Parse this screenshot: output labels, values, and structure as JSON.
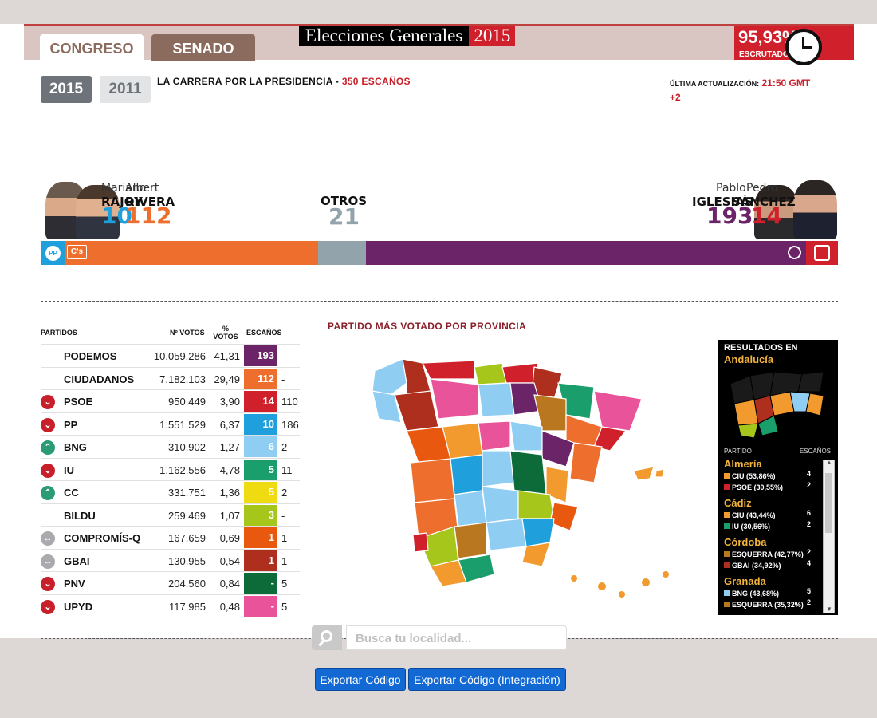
{
  "header": {
    "tabs": [
      "CONGRESO",
      "SENADO"
    ],
    "title_main": "Elecciones Generales",
    "title_year": "2015",
    "escrutado_pct": "95,93%",
    "escrutado_label": "ESCRUTADO"
  },
  "years": [
    "2015",
    "2011"
  ],
  "carrera": {
    "label": "LA CARRERA POR LA PRESIDENCIA -",
    "seats": "350 ESCAÑOS"
  },
  "update": {
    "label": "ÚLTIMA ACTUALIZACIÓN:",
    "time": "21:50 GMT",
    "tz": "+2"
  },
  "candidates": {
    "rajoy": {
      "first": "Mariano",
      "last": "RAJOY",
      "seats": "10",
      "color": "#1fa0dd"
    },
    "rivera": {
      "first": "Albert",
      "last": "RIVERA",
      "seats": "112",
      "color": "#ee6f2d"
    },
    "otros": {
      "last": "OTROS",
      "seats": "21",
      "color": "#93a3ab"
    },
    "iglesias": {
      "first": "Pablo",
      "last": "IGLESIAS",
      "seats": "193",
      "color": "#6b2467"
    },
    "sanchez": {
      "first": "Pedro",
      "last": "SÁNCHEZ",
      "seats": "14",
      "color": "#d0202b"
    }
  },
  "table": {
    "headers": {
      "partidos": "PARTIDOS",
      "votos": "Nº VOTOS",
      "pct": "% VOTOS",
      "escanos": "ESCAÑOS"
    },
    "rows": [
      {
        "trend": "none",
        "name": "PODEMOS",
        "votes": "10.059.286",
        "pct": "41,31",
        "seats": "193",
        "old": "-",
        "color": "#6b2467"
      },
      {
        "trend": "none",
        "name": "CIUDADANOS",
        "votes": "7.182.103",
        "pct": "29,49",
        "seats": "112",
        "old": "-",
        "color": "#ee6f2d"
      },
      {
        "trend": "down",
        "name": "PSOE",
        "votes": "950.449",
        "pct": "3,90",
        "seats": "14",
        "old": "110",
        "color": "#d0202b"
      },
      {
        "trend": "down",
        "name": "PP",
        "votes": "1.551.529",
        "pct": "6,37",
        "seats": "10",
        "old": "186",
        "color": "#1fa0dd"
      },
      {
        "trend": "up",
        "name": "BNG",
        "votes": "310.902",
        "pct": "1,27",
        "seats": "6",
        "old": "2",
        "color": "#8fcdf3"
      },
      {
        "trend": "down",
        "name": "IU",
        "votes": "1.162.556",
        "pct": "4,78",
        "seats": "5",
        "old": "11",
        "color": "#1a9e6b"
      },
      {
        "trend": "up",
        "name": "CC",
        "votes": "331.751",
        "pct": "1,36",
        "seats": "5",
        "old": "2",
        "color": "#efdb12"
      },
      {
        "trend": "none",
        "name": "BILDU",
        "votes": "259.469",
        "pct": "1,07",
        "seats": "3",
        "old": "-",
        "color": "#a7c61c"
      },
      {
        "trend": "same",
        "name": "COMPROMÍS-Q",
        "votes": "167.659",
        "pct": "0,69",
        "seats": "1",
        "old": "1",
        "color": "#e9580f"
      },
      {
        "trend": "same",
        "name": "GBAI",
        "votes": "130.955",
        "pct": "0,54",
        "seats": "1",
        "old": "1",
        "color": "#ae2f1d"
      },
      {
        "trend": "down",
        "name": "PNV",
        "votes": "204.560",
        "pct": "0,84",
        "seats": "-",
        "old": "5",
        "color": "#0d6b3a"
      },
      {
        "trend": "down",
        "name": "UPYD",
        "votes": "117.985",
        "pct": "0,48",
        "seats": "-",
        "old": "5",
        "color": "#e9539a"
      }
    ]
  },
  "map_title": "PARTIDO MÁS VOTADO POR PROVINCIA",
  "panel": {
    "title": "RESULTADOS EN",
    "region": "Andalucía",
    "col_party": "PARTIDO",
    "col_seats": "ESCAÑOS",
    "provinces": [
      {
        "name": "Almería",
        "lines": [
          {
            "label": "CIU (53,86%)",
            "seats": "4",
            "color": "#f29a2e"
          },
          {
            "label": "PSOE (30,55%)",
            "seats": "2",
            "color": "#d0202b"
          }
        ]
      },
      {
        "name": "Cádiz",
        "lines": [
          {
            "label": "CIU (43,44%)",
            "seats": "6",
            "color": "#f29a2e"
          },
          {
            "label": "IU (30,56%)",
            "seats": "2",
            "color": "#1a9e6b"
          }
        ]
      },
      {
        "name": "Córdoba",
        "lines": [
          {
            "label": "ESQUERRA (42,77%)",
            "seats": "2",
            "color": "#b9781f"
          },
          {
            "label": "GBAI (34,92%)",
            "seats": "4",
            "color": "#ae2f1d"
          }
        ]
      },
      {
        "name": "Granada",
        "lines": [
          {
            "label": "BNG (43,68%)",
            "seats": "5",
            "color": "#8fcdf3"
          },
          {
            "label": "ESQUERRA (35,32%)",
            "seats": "2",
            "color": "#b9781f"
          }
        ]
      }
    ]
  },
  "search": {
    "placeholder": "Busca tu localidad..."
  },
  "buttons": {
    "export": "Exportar Código",
    "export_int": "Exportar Código (Integración)"
  }
}
